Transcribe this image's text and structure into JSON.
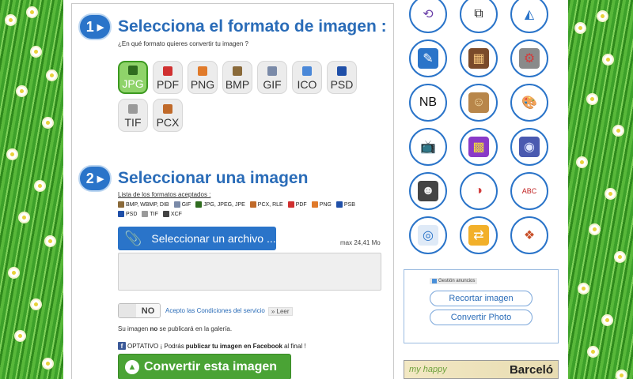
{
  "step1": {
    "number": "1",
    "title": "Selecciona el formato de imagen :",
    "subtitle": "¿En qué formato quieres convertir tu imagen ?"
  },
  "formats": [
    {
      "label": "JPG",
      "active": true,
      "icon": "camera-icon",
      "color": "#2f6c1f"
    },
    {
      "label": "PDF",
      "active": false,
      "icon": "pdf-icon",
      "color": "#d03030"
    },
    {
      "label": "PNG",
      "active": false,
      "icon": "png-icon",
      "color": "#e07a2a"
    },
    {
      "label": "BMP",
      "active": false,
      "icon": "bmp-icon",
      "color": "#8a6a3a"
    },
    {
      "label": "GIF",
      "active": false,
      "icon": "gif-icon",
      "color": "#7a8aa8"
    },
    {
      "label": "ICO",
      "active": false,
      "icon": "ico-icon",
      "color": "#4a88d8"
    },
    {
      "label": "PSD",
      "active": false,
      "icon": "psd-icon",
      "color": "#1f4fa8"
    },
    {
      "label": "TIF",
      "active": false,
      "icon": "tif-icon",
      "color": "#9a9a9a"
    },
    {
      "label": "PCX",
      "active": false,
      "icon": "pcx-icon",
      "color": "#c06a2a"
    }
  ],
  "step2": {
    "number": "2",
    "title": "Seleccionar una imagen"
  },
  "accepted": {
    "title": "Lista de los formatos aceptados :",
    "items": [
      {
        "label": "BMP, WBMP, DIB",
        "color": "#8a6a3a"
      },
      {
        "label": "GIF",
        "color": "#7a8aa8"
      },
      {
        "label": "JPG, JPEG, JPE",
        "color": "#2f6c1f"
      },
      {
        "label": "PCX, RLE",
        "color": "#c06a2a"
      },
      {
        "label": "PDF",
        "color": "#d03030"
      },
      {
        "label": "PNG",
        "color": "#e07a2a"
      },
      {
        "label": "PSB",
        "color": "#1f4fa8"
      },
      {
        "label": "PSD",
        "color": "#1f4fa8"
      },
      {
        "label": "TIF",
        "color": "#9a9a9a"
      },
      {
        "label": "XCF",
        "color": "#444444"
      }
    ]
  },
  "upload": {
    "button_label": "Seleccionar un archivo ...",
    "max_size": "max 24,41 Mo"
  },
  "terms": {
    "toggle_label": "NO",
    "text": "Acepto las Condiciones del servicio",
    "read_label": "» Leer"
  },
  "gallery_note": {
    "before": "Su imagen ",
    "bold": "no",
    "after": " se publicará en la galería."
  },
  "facebook_note": {
    "lead": "OPTATIVO ¡ Podrás ",
    "bold": "publicar tu imagen en Facebook",
    "tail": " al final !"
  },
  "convert_button": "Convertir esta imagen",
  "tools": [
    {
      "name": "rotate-icon",
      "glyph": "⟲",
      "bg": "#ffffff",
      "fg": "#6a3fa8"
    },
    {
      "name": "crop-icon",
      "glyph": "⧉",
      "bg": "#ffffff",
      "fg": "#222222"
    },
    {
      "name": "perspective-icon",
      "glyph": "◭",
      "bg": "#ffffff",
      "fg": "#2a74c9"
    },
    {
      "name": "pen-icon",
      "glyph": "✎",
      "bg": "#2a74c9",
      "fg": "#ffffff"
    },
    {
      "name": "filmstrip-icon",
      "glyph": "▦",
      "bg": "#7a4a2a",
      "fg": "#f2c27a"
    },
    {
      "name": "stamp-icon",
      "glyph": "⚙",
      "bg": "#8a8a8a",
      "fg": "#d23c3c"
    },
    {
      "name": "black-white-icon",
      "glyph": "NB",
      "bg": "#ffffff",
      "fg": "#111111"
    },
    {
      "name": "sepia-icon",
      "glyph": "☺",
      "bg": "#b8864a",
      "fg": "#f4dca8"
    },
    {
      "name": "palette-icon",
      "glyph": "🎨",
      "bg": "#ffffff",
      "fg": "#8a6a3a"
    },
    {
      "name": "tv-icon",
      "glyph": "📺",
      "bg": "#ffffff",
      "fg": "#b02a2a"
    },
    {
      "name": "pop-art-icon",
      "glyph": "▩",
      "bg": "#8a3ac8",
      "fg": "#f2e03a"
    },
    {
      "name": "blue-effect-icon",
      "glyph": "◉",
      "bg": "#4a5ab0",
      "fg": "#dfe6ff"
    },
    {
      "name": "portrait-photo-icon",
      "glyph": "☻",
      "bg": "#444444",
      "fg": "#eeeeee"
    },
    {
      "name": "3d-glasses-icon",
      "glyph": "◑",
      "bg": "#ffffff",
      "fg": "#d23c3c"
    },
    {
      "name": "text-stamp-icon",
      "glyph": "ABC",
      "bg": "#ffffff",
      "fg": "#c02020"
    },
    {
      "name": "badge-icon",
      "glyph": "◎",
      "bg": "#dfeaf7",
      "fg": "#2a74c9"
    },
    {
      "name": "convert-photo-icon",
      "glyph": "⇄",
      "bg": "#f2b02a",
      "fg": "#ffffff"
    },
    {
      "name": "apps-collage-icon",
      "glyph": "❖",
      "bg": "#ffffff",
      "fg": "#c8502a"
    }
  ],
  "ads": {
    "label": "Gestión anuncios",
    "crop_button": "Recortar imagen",
    "convert_button": "Convertir Photo"
  },
  "banner": {
    "left": "my happy",
    "right": "Barceló"
  }
}
